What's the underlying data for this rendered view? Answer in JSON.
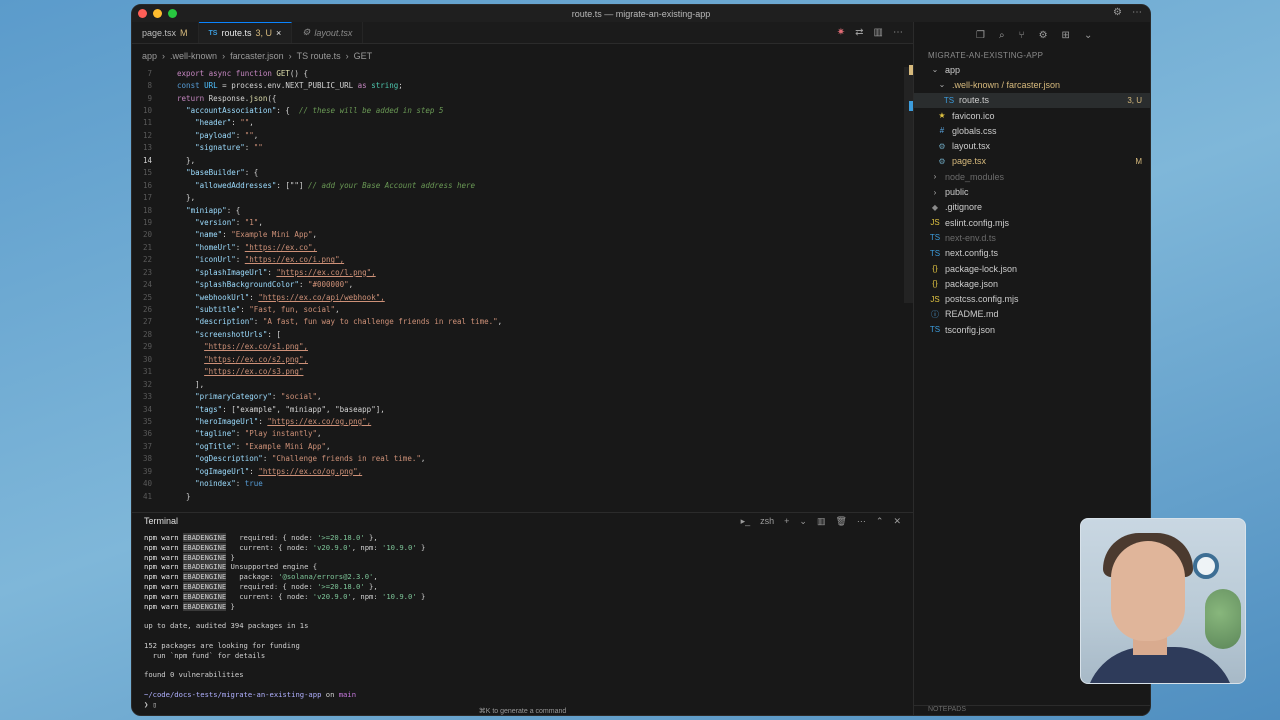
{
  "window": {
    "title": "route.ts — migrate-an-existing-app"
  },
  "tabs": [
    {
      "label": "page.tsx",
      "status": "M"
    },
    {
      "badge": "TS",
      "label": "route.ts",
      "status": "3, U",
      "close": "×"
    },
    {
      "label": "layout.tsx"
    }
  ],
  "breadcrumb": [
    "app",
    ".well-known",
    "farcaster.json",
    "TS route.ts",
    "GET"
  ],
  "editor": {
    "line_numbers": [
      "7",
      "8",
      "9",
      "10",
      "11",
      "12",
      "13",
      "14",
      "15",
      "16",
      "17",
      "18",
      "19",
      "20",
      "21",
      "22",
      "23",
      "24",
      "25",
      "26",
      "27",
      "28",
      "29",
      "30",
      "31",
      "32",
      "33",
      "34",
      "35",
      "36",
      "37",
      "38",
      "39",
      "40",
      "41"
    ],
    "lines": [
      "  export async function GET() {",
      "  const URL = process.env.NEXT_PUBLIC_URL as string;",
      "  return Response.json({",
      "    \"accountAssociation\": {  // these will be added in step 5",
      "      \"header\": \"\",",
      "      \"payload\": \"\",",
      "      \"signature\": \"\"",
      "    },",
      "    \"baseBuilder\": {",
      "      \"allowedAddresses\": [\"\"] // add your Base Account address here",
      "    },",
      "    \"miniapp\": {",
      "      \"version\": \"1\",",
      "      \"name\": \"Example Mini App\",",
      "      \"homeUrl\": \"https://ex.co\",",
      "      \"iconUrl\": \"https://ex.co/i.png\",",
      "      \"splashImageUrl\": \"https://ex.co/l.png\",",
      "      \"splashBackgroundColor\": \"#000000\",",
      "      \"webhookUrl\": \"https://ex.co/api/webhook\",",
      "      \"subtitle\": \"Fast, fun, social\",",
      "      \"description\": \"A fast, fun way to challenge friends in real time.\",",
      "      \"screenshotUrls\": [",
      "        \"https://ex.co/s1.png\",",
      "        \"https://ex.co/s2.png\",",
      "        \"https://ex.co/s3.png\"",
      "      ],",
      "      \"primaryCategory\": \"social\",",
      "      \"tags\": [\"example\", \"miniapp\", \"baseapp\"],",
      "      \"heroImageUrl\": \"https://ex.co/og.png\",",
      "      \"tagline\": \"Play instantly\",",
      "      \"ogTitle\": \"Example Mini App\",",
      "      \"ogDescription\": \"Challenge friends in real time.\",",
      "      \"ogImageUrl\": \"https://ex.co/og.png\",",
      "      \"noindex\": true",
      "    }"
    ]
  },
  "explorer": {
    "header": "MIGRATE-AN-EXISTING-APP",
    "items": [
      {
        "label": "app",
        "indent": 1,
        "icon": "folder-open-icon"
      },
      {
        "label": ".well-known / farcaster.json",
        "indent": 2,
        "icon": "folder-open-icon",
        "color": "#d7ba7d"
      },
      {
        "label": "route.ts",
        "indent": 3,
        "icon": "ts-file-icon",
        "badge": "3, U",
        "selected": true
      },
      {
        "label": "favicon.ico",
        "indent": 2,
        "icon": "star-icon"
      },
      {
        "label": "globals.css",
        "indent": 2,
        "icon": "hash-icon"
      },
      {
        "label": "layout.tsx",
        "indent": 2,
        "icon": "gear-icon"
      },
      {
        "label": "page.tsx",
        "indent": 2,
        "icon": "gear-icon",
        "badge": "M",
        "color": "#d7ba7d"
      },
      {
        "label": "node_modules",
        "indent": 1,
        "icon": "chevron-right-icon",
        "dim": true
      },
      {
        "label": "public",
        "indent": 1,
        "icon": "chevron-right-icon"
      },
      {
        "label": ".gitignore",
        "indent": 1,
        "icon": "git-icon"
      },
      {
        "label": "eslint.config.mjs",
        "indent": 1,
        "icon": "js-file-icon"
      },
      {
        "label": "next-env.d.ts",
        "indent": 1,
        "icon": "ts-file-icon",
        "dim": true
      },
      {
        "label": "next.config.ts",
        "indent": 1,
        "icon": "ts-file-icon"
      },
      {
        "label": "package-lock.json",
        "indent": 1,
        "icon": "json-file-icon"
      },
      {
        "label": "package.json",
        "indent": 1,
        "icon": "json-file-icon"
      },
      {
        "label": "postcss.config.mjs",
        "indent": 1,
        "icon": "js-file-icon"
      },
      {
        "label": "README.md",
        "indent": 1,
        "icon": "info-icon"
      },
      {
        "label": "tsconfig.json",
        "indent": 1,
        "icon": "ts-file-icon"
      }
    ],
    "notepads": "NOTEPADS"
  },
  "terminal": {
    "title": "Terminal",
    "shell": "zsh",
    "lines": [
      "npm warn EBADENGINE   required: { node: '>=20.18.0' },",
      "npm warn EBADENGINE   current: { node: 'v20.9.0', npm: '10.9.0' }",
      "npm warn EBADENGINE }",
      "npm warn EBADENGINE Unsupported engine {",
      "npm warn EBADENGINE   package: '@solana/errors@2.3.0',",
      "npm warn EBADENGINE   required: { node: '>=20.18.0' },",
      "npm warn EBADENGINE   current: { node: 'v20.9.0', npm: '10.9.0' }",
      "npm warn EBADENGINE }",
      "",
      "up to date, audited 394 packages in 1s",
      "",
      "152 packages are looking for funding",
      "  run `npm fund` for details",
      "",
      "found 0 vulnerabilities",
      "",
      "~/code/docs-tests/migrate-an-existing-app on main",
      "❯ ▯"
    ],
    "hint": "⌘K to generate a command"
  },
  "colors": {
    "accent": "#0a84ff",
    "traffic": [
      "#ff5f57",
      "#febc2e",
      "#28c840"
    ]
  }
}
